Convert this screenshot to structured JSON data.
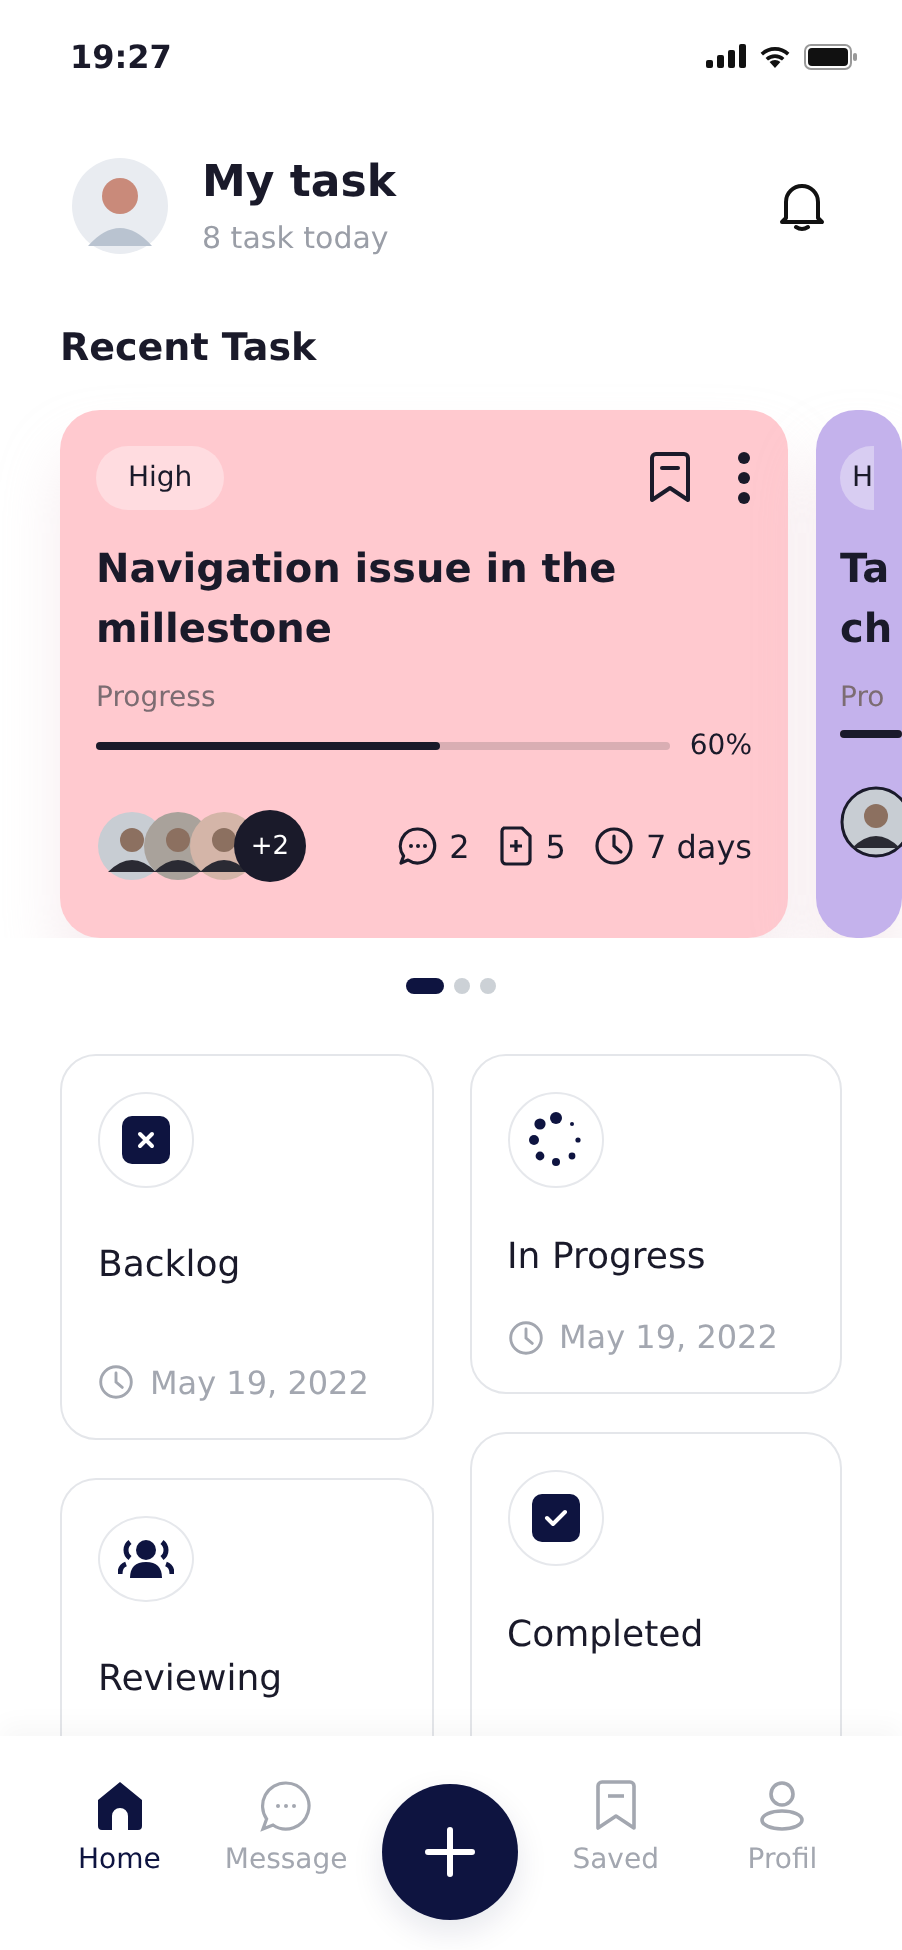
{
  "status_bar": {
    "time": "19:27"
  },
  "header": {
    "title": "My task",
    "subtitle": "8 task today"
  },
  "section_title": "Recent Task",
  "task_cards": [
    {
      "kind": "full",
      "color": "#ffc9cf",
      "priority": "High",
      "title_lines": [
        "Navigation issue in the",
        "millestone"
      ],
      "progress_label": "Progress",
      "level": 0.6,
      "percent": "60%",
      "extra_members": "+2",
      "comments": "2",
      "files": "5",
      "due": "7 days"
    },
    {
      "kind": "peek",
      "color": "#c4b2ec",
      "priority": "H",
      "title_lines": [
        "Ta",
        "ch"
      ],
      "progress_label": "Pro"
    }
  ],
  "pager": [
    {
      "selected": true
    },
    {
      "selected": false
    },
    {
      "selected": false
    }
  ],
  "status_columns": [
    [
      {
        "kind": "backlog",
        "label": "Backlog",
        "date": "May 19, 2022"
      },
      {
        "kind": "review",
        "label": "Reviewing"
      }
    ],
    [
      {
        "kind": "progress",
        "label": "In Progress",
        "date": "May 19, 2022"
      },
      {
        "kind": "done",
        "label": "Completed"
      }
    ]
  ],
  "nav": [
    {
      "kind": "home",
      "label": "Home",
      "selected": true
    },
    {
      "kind": "message",
      "label": "Message",
      "selected": false
    },
    {
      "kind": "add"
    },
    {
      "kind": "saved",
      "label": "Saved",
      "selected": false
    },
    {
      "kind": "profile",
      "label": "Profil",
      "selected": false
    }
  ]
}
